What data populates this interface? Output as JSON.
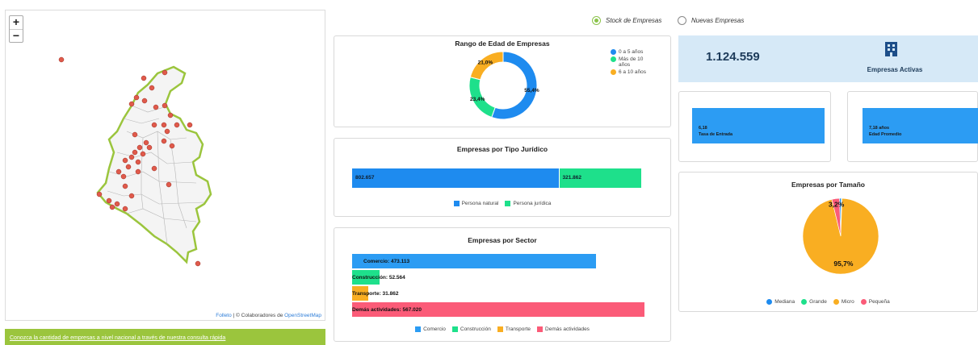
{
  "map": {
    "zoom_in": "+",
    "zoom_out": "−",
    "attribution_leaflet": "Folleto",
    "attribution_sep": " | © Colaboradores de ",
    "attribution_osm": "OpenStreetMap",
    "marker_color": "#e05a4b",
    "border_color": "#9bc53d"
  },
  "banner": {
    "text": "Conozca la cantidad de empresas a nivel nacional a través de nuestra consulta rápida"
  },
  "radios": [
    {
      "label": "Stock de Empresas",
      "selected": true
    },
    {
      "label": "Nuevas Empresas",
      "selected": false
    }
  ],
  "kpi": {
    "value": "1.124.559",
    "label": "Empresas Activas",
    "icon": "building-icon",
    "entry_rate_value": "6,18",
    "entry_rate_label": "Tasa de Entrada",
    "avg_age_value": "7,18 años",
    "avg_age_label": "Edad Promedio"
  },
  "colors": {
    "blue": "#1e8bef",
    "green": "#1ee08b",
    "orange": "#f9ae22",
    "red": "#fb5b78",
    "kpi_bg": "#d6e9f7"
  },
  "chart_data": [
    {
      "type": "pie",
      "subtype": "donut",
      "title": "Rango de Edad de Empresas",
      "labels": [
        "0 a 5 años",
        "Más de 10 años",
        "6 a 10 años"
      ],
      "values": [
        55.4,
        23.4,
        21.0
      ],
      "data_labels": [
        "55,4%",
        "23,4%",
        "21,0%"
      ],
      "colors": [
        "#1e8bef",
        "#1ee08b",
        "#f9ae22"
      ],
      "legend": "right"
    },
    {
      "type": "bar",
      "orientation": "horizontal-stacked",
      "title": "Empresas por Tipo Jurídico",
      "series": [
        {
          "name": "Persona natural",
          "values": [
            802657
          ],
          "label": "802.657",
          "color": "#1e8bef"
        },
        {
          "name": "Persona jurídica",
          "values": [
            321862
          ],
          "label": "321.862",
          "color": "#1ee08b"
        }
      ],
      "legend": "bottom"
    },
    {
      "type": "bar",
      "orientation": "horizontal",
      "title": "Empresas por Sector",
      "categories": [
        "Comercio",
        "Construcción",
        "Transporte",
        "Demás actividades"
      ],
      "values": [
        473113,
        52564,
        31862,
        567020
      ],
      "data_labels": [
        "Comercio: 473.113",
        "Construcción: 52.564",
        "Transporte: 31.862",
        "Demás actividades: 567.020"
      ],
      "colors": [
        "#2c9cf3",
        "#1ee08b",
        "#f9ae22",
        "#fb5b78"
      ],
      "legend": "bottom"
    },
    {
      "type": "pie",
      "title": "Empresas por Tamaño",
      "labels": [
        "Mediana",
        "Grande",
        "Micro",
        "Pequeña"
      ],
      "values": [
        0.8,
        0.3,
        95.7,
        3.2
      ],
      "data_labels": [
        "",
        "",
        "95,7%",
        "3,2%"
      ],
      "colors": [
        "#1e8bef",
        "#1ee08b",
        "#f9ae22",
        "#fb5b78"
      ],
      "legend": "bottom"
    }
  ]
}
